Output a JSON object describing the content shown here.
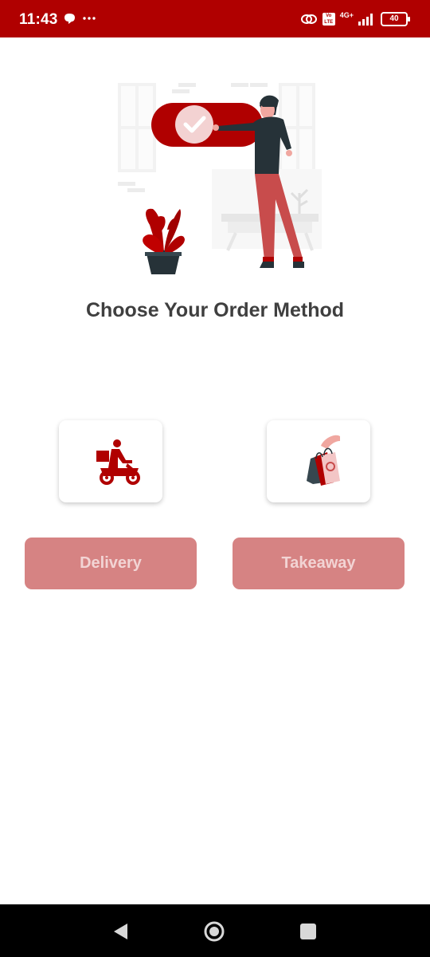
{
  "status_bar": {
    "time": "11:43",
    "network_label": "4G+",
    "volte_label": "Vo LTE",
    "battery_level": "40"
  },
  "main": {
    "title": "Choose Your Order Method",
    "options": [
      {
        "label": "Delivery",
        "icon": "scooter-delivery-icon"
      },
      {
        "label": "Takeaway",
        "icon": "shopping-bags-icon"
      }
    ]
  },
  "colors": {
    "brand_red": "#b00000",
    "button_bg": "#d68383",
    "button_text": "#f2d4d4",
    "title_text": "#3f3f3f"
  },
  "navigation_bar": {
    "icons": [
      "back-icon",
      "home-icon",
      "recent-apps-icon"
    ]
  }
}
